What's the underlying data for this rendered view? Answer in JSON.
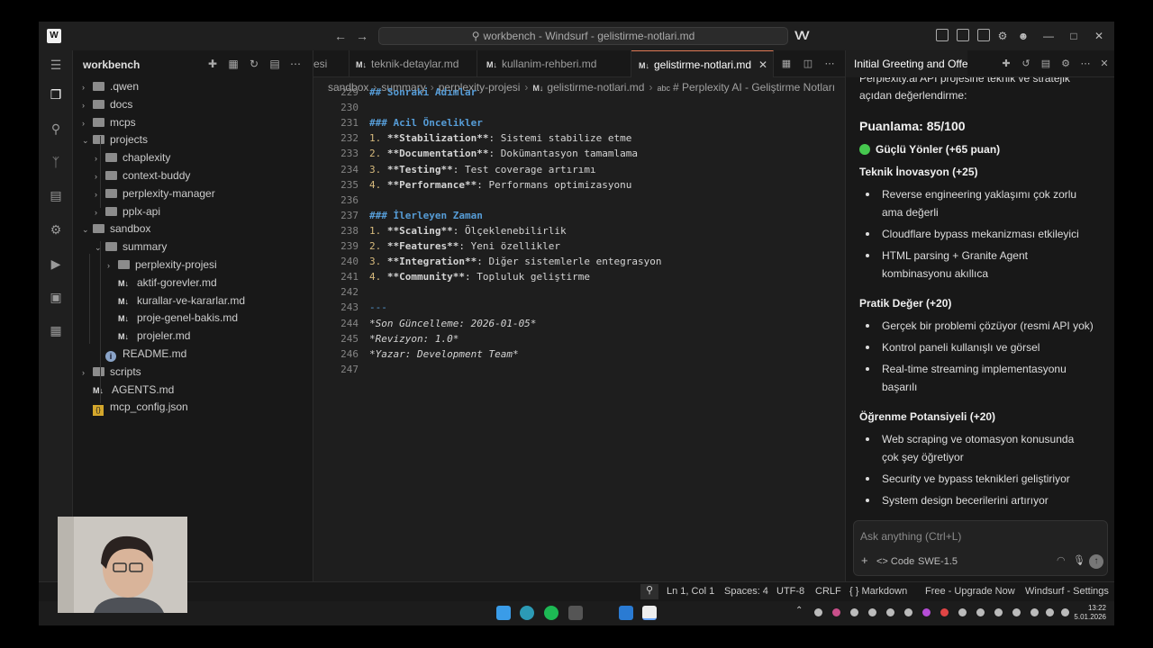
{
  "window": {
    "title": "workbench - Windsurf - gelistirme-notlari.md"
  },
  "explorer": {
    "title": "workbench",
    "tree": [
      {
        "label": ".qwen",
        "type": "folder",
        "depth": 1,
        "expanded": false
      },
      {
        "label": "docs",
        "type": "folder",
        "depth": 1,
        "expanded": false
      },
      {
        "label": "mcps",
        "type": "folder",
        "depth": 1,
        "expanded": false
      },
      {
        "label": "projects",
        "type": "folder",
        "depth": 1,
        "expanded": true
      },
      {
        "label": "chaplexity",
        "type": "folder",
        "depth": 2,
        "expanded": false
      },
      {
        "label": "context-buddy",
        "type": "folder",
        "depth": 2,
        "expanded": false
      },
      {
        "label": "perplexity-manager",
        "type": "folder",
        "depth": 2,
        "expanded": false
      },
      {
        "label": "pplx-api",
        "type": "folder",
        "depth": 2,
        "expanded": false
      },
      {
        "label": "sandbox",
        "type": "folder",
        "depth": 1,
        "expanded": true
      },
      {
        "label": "summary",
        "type": "folder",
        "depth": 2,
        "expanded": true
      },
      {
        "label": "perplexity-projesi",
        "type": "folder",
        "depth": 3,
        "expanded": false
      },
      {
        "label": "aktif-gorevler.md",
        "type": "md",
        "depth": 3
      },
      {
        "label": "kurallar-ve-kararlar.md",
        "type": "md",
        "depth": 3
      },
      {
        "label": "proje-genel-bakis.md",
        "type": "md",
        "depth": 3
      },
      {
        "label": "projeler.md",
        "type": "md",
        "depth": 3
      },
      {
        "label": "README.md",
        "type": "info",
        "depth": 2
      },
      {
        "label": "scripts",
        "type": "folder",
        "depth": 1,
        "expanded": false
      },
      {
        "label": "AGENTS.md",
        "type": "md",
        "depth": 1
      },
      {
        "label": "mcp_config.json",
        "type": "json",
        "depth": 1
      }
    ]
  },
  "editor": {
    "tabs": [
      {
        "label": "esi",
        "active": false
      },
      {
        "label": "teknik-detaylar.md",
        "active": false
      },
      {
        "label": "kullanim-rehberi.md",
        "active": false
      },
      {
        "label": "gelistirme-notlari.md",
        "active": true
      }
    ],
    "md_badge": "M↓",
    "breadcrumb": [
      "sandbox",
      "summary",
      "perplexity-projesi",
      "gelistirme-notlari.md",
      "# Perplexity AI - Geliştirme Notları"
    ],
    "lines": [
      {
        "n": "229",
        "t": "partial",
        "text": "## Sonraki Adımlar"
      },
      {
        "n": "230",
        "t": "blank",
        "text": ""
      },
      {
        "n": "231",
        "t": "h",
        "text": "### Acil Öncelikler"
      },
      {
        "n": "232",
        "t": "item",
        "num": "1.",
        "bold": "**Stabilization**",
        "rest": ": Sistemi stabilize etme"
      },
      {
        "n": "233",
        "t": "item",
        "num": "2.",
        "bold": "**Documentation**",
        "rest": ": Dokümantasyon tamamlama"
      },
      {
        "n": "234",
        "t": "item",
        "num": "3.",
        "bold": "**Testing**",
        "rest": ": Test coverage artırımı"
      },
      {
        "n": "235",
        "t": "item",
        "num": "4.",
        "bold": "**Performance**",
        "rest": ": Performans optimizasyonu"
      },
      {
        "n": "236",
        "t": "blank",
        "text": ""
      },
      {
        "n": "237",
        "t": "h",
        "text": "### İlerleyen Zaman"
      },
      {
        "n": "238",
        "t": "item",
        "num": "1.",
        "bold": "**Scaling**",
        "rest": ": Ölçeklenebilirlik"
      },
      {
        "n": "239",
        "t": "item",
        "num": "2.",
        "bold": "**Features**",
        "rest": ": Yeni özellikler"
      },
      {
        "n": "240",
        "t": "item",
        "num": "3.",
        "bold": "**Integration**",
        "rest": ": Diğer sistemlerle entegrasyon"
      },
      {
        "n": "241",
        "t": "item",
        "num": "4.",
        "bold": "**Community**",
        "rest": ": Topluluk geliştirme"
      },
      {
        "n": "242",
        "t": "blank",
        "text": ""
      },
      {
        "n": "243",
        "t": "rule",
        "text": "---"
      },
      {
        "n": "244",
        "t": "ital",
        "text": "*Son Güncelleme: 2026-01-05*"
      },
      {
        "n": "245",
        "t": "ital",
        "text": "*Revizyon: 1.0*"
      },
      {
        "n": "246",
        "t": "ital",
        "text": "*Yazar: Development Team*"
      },
      {
        "n": "247",
        "t": "blank",
        "text": ""
      }
    ]
  },
  "cascade": {
    "tab_title": "Initial Greeting and Offe",
    "intro_1": "Perplexity.ai API projesine teknik ve stratejik",
    "intro_2": "açıdan değerlendirme:",
    "score": "Puanlama: 85/100",
    "strengths": "Güçlü Yönler (+65 puan)",
    "sections": [
      {
        "title": "Teknik İnovasyon (+25)",
        "bullets": [
          [
            "Reverse engineering yaklaşımı çok zorlu",
            "ama değerli"
          ],
          [
            "Cloudflare bypass mekanizması etkileyici"
          ],
          [
            "HTML parsing + Granite Agent",
            "kombinasyonu akıllıca"
          ]
        ]
      },
      {
        "title": "Pratik Değer (+20)",
        "bullets": [
          [
            "Gerçek bir problemi çözüyor (resmi API yok)"
          ],
          [
            "Kontrol paneli kullanışlı ve görsel"
          ],
          [
            "Real-time streaming implementasyonu",
            "başarılı"
          ]
        ]
      },
      {
        "title": "Öğrenme Potansiyeli (+20)",
        "bullets": [
          [
            "Web scraping ve otomasyon konusunda",
            "çok şey öğretiyor"
          ],
          [
            "Security ve bypass teknikleri geliştiriyor"
          ],
          [
            "System design becerilerini artırıyor"
          ]
        ]
      }
    ],
    "input_placeholder": "Ask anything (Ctrl+L)",
    "mode_label": "Code",
    "model_label": "SWE-1.5"
  },
  "statusbar": {
    "position": "Ln 1, Col 1",
    "spaces": "Spaces: 4",
    "encoding": "UTF-8",
    "eol": "CRLF",
    "language": "Markdown",
    "upgrade": "Free - Upgrade Now",
    "settings": "Windsurf - Settings"
  },
  "taskbar": {
    "time": "13:22",
    "date": "5.01.2026"
  },
  "colors": {
    "accent_tab": "#e07a55",
    "green": "#46c84f",
    "heading": "#569cd6",
    "list_number": "#d7ba7d"
  }
}
